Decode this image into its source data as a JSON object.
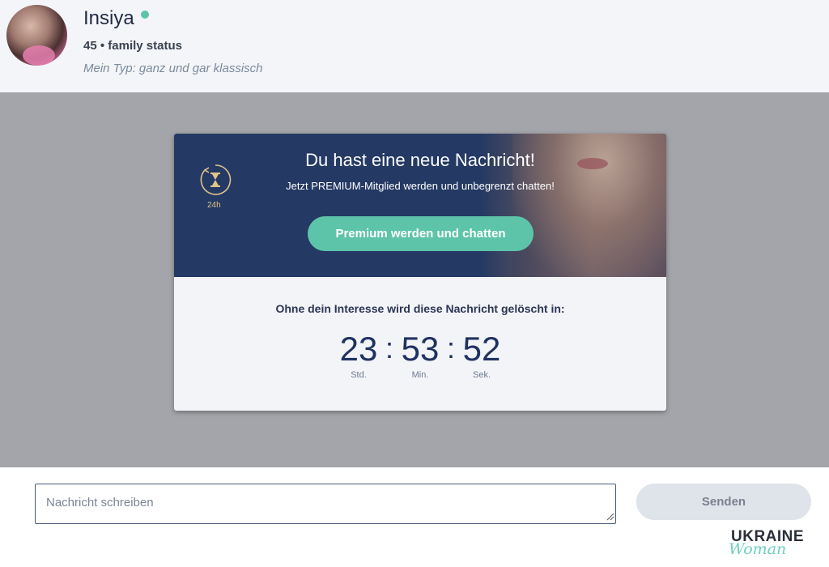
{
  "profile": {
    "name": "Insiya",
    "status": "45 • family status",
    "type": "Mein Typ: ganz und gar klassisch",
    "online_color": "#5ec4a9"
  },
  "modal": {
    "title": "Du hast eine neue Nachricht!",
    "subtitle": "Jetzt PREMIUM-Mitglied werden und unbegrenzt chatten!",
    "timer_caption": "24h",
    "cta_label": "Premium werden und chatten",
    "warning": "Ohne dein Interesse wird diese Nachricht gelöscht in:",
    "countdown": {
      "hours": "23",
      "minutes": "53",
      "seconds": "52",
      "hours_label": "Std.",
      "minutes_label": "Min.",
      "seconds_label": "Sek.",
      "separator": ":"
    }
  },
  "composer": {
    "placeholder": "Nachricht schreiben",
    "send_label": "Senden"
  },
  "watermark": {
    "line1": "UKRAINE",
    "line2": "Woman"
  },
  "colors": {
    "accent": "#5ec4a9",
    "banner": "#243963",
    "overlay": "#a3a5aa"
  }
}
